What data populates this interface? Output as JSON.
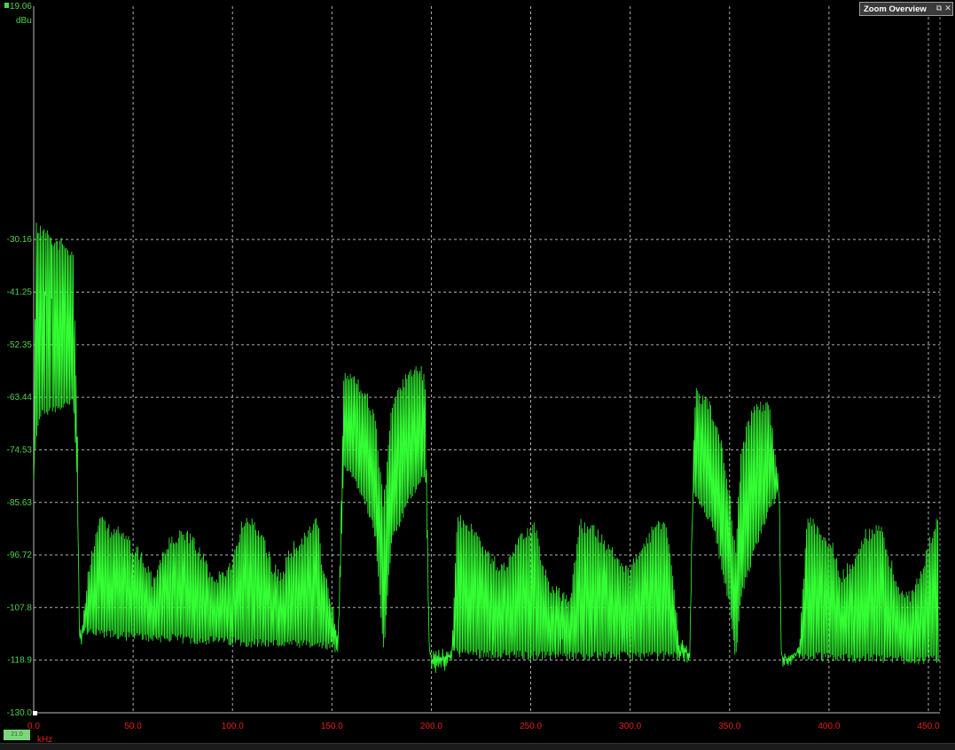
{
  "zoom_overview": {
    "label": "Zoom Overview",
    "restore_icon": "restore-icon",
    "close_icon": "close-icon"
  },
  "corner_readout": "21.0",
  "colors": {
    "background": "#000000",
    "trace": "#33ff33",
    "y_labels": "#4dd24d",
    "x_labels": "#e02020",
    "grid": "#cfcfcf"
  },
  "chart_data": {
    "type": "line",
    "title": "",
    "xlabel": "kHz",
    "ylabel": "dBu",
    "xlim": [
      0,
      455
    ],
    "ylim": [
      -130.0,
      19.06
    ],
    "y_ticks": [
      "19.06",
      "-30.16",
      "-41.25",
      "-52.35",
      "-63.44",
      "-74.53",
      "-85.63",
      "-96.72",
      "-107.8",
      "-118.9",
      "-130.0"
    ],
    "x_ticks": [
      "0.0",
      "50.0",
      "100.0",
      "150.0",
      "200.0",
      "250.0",
      "300.0",
      "350.0",
      "400.0",
      "450.0"
    ],
    "grid": true,
    "series": [
      {
        "values_description_free": true,
        "envelope_upper": [
          [
            0,
            -79
          ],
          [
            1,
            -26
          ],
          [
            5,
            -27
          ],
          [
            10,
            -29
          ],
          [
            15,
            -30
          ],
          [
            20,
            -31
          ],
          [
            22,
            -70
          ],
          [
            23,
            -113
          ],
          [
            24,
            -113
          ],
          [
            27,
            -100
          ],
          [
            33,
            -88
          ],
          [
            38,
            -90
          ],
          [
            45,
            -91
          ],
          [
            50,
            -94
          ],
          [
            55,
            -96
          ],
          [
            60,
            -101
          ],
          [
            63,
            -97
          ],
          [
            68,
            -93
          ],
          [
            75,
            -91
          ],
          [
            80,
            -92
          ],
          [
            85,
            -96
          ],
          [
            90,
            -101
          ],
          [
            100,
            -97
          ],
          [
            105,
            -88
          ],
          [
            110,
            -89
          ],
          [
            115,
            -91
          ],
          [
            120,
            -98
          ],
          [
            125,
            -100
          ],
          [
            128,
            -95
          ],
          [
            135,
            -92
          ],
          [
            140,
            -90
          ],
          [
            143,
            -88
          ],
          [
            145,
            -97
          ],
          [
            152,
            -110
          ],
          [
            153,
            -113
          ],
          [
            154,
            -99
          ],
          [
            156,
            -57
          ],
          [
            160,
            -58
          ],
          [
            167,
            -61
          ],
          [
            172,
            -68
          ],
          [
            176,
            -85
          ],
          [
            180,
            -64
          ],
          [
            188,
            -57
          ],
          [
            195,
            -56
          ],
          [
            197,
            -60
          ],
          [
            199,
            -116
          ],
          [
            200,
            -119
          ],
          [
            210,
            -118
          ],
          [
            213,
            -88
          ],
          [
            220,
            -89
          ],
          [
            225,
            -93
          ],
          [
            230,
            -96
          ],
          [
            235,
            -98
          ],
          [
            238,
            -97
          ],
          [
            245,
            -91
          ],
          [
            252,
            -89
          ],
          [
            255,
            -96
          ],
          [
            260,
            -103
          ],
          [
            270,
            -104
          ],
          [
            275,
            -89
          ],
          [
            282,
            -90
          ],
          [
            290,
            -94
          ],
          [
            297,
            -99
          ],
          [
            300,
            -98
          ],
          [
            305,
            -94
          ],
          [
            312,
            -90
          ],
          [
            318,
            -88
          ],
          [
            321,
            -98
          ],
          [
            325,
            -116
          ],
          [
            330,
            -118
          ],
          [
            332,
            -70
          ],
          [
            333,
            -61
          ],
          [
            340,
            -64
          ],
          [
            345,
            -70
          ],
          [
            350,
            -82
          ],
          [
            353,
            -95
          ],
          [
            356,
            -72
          ],
          [
            362,
            -65
          ],
          [
            370,
            -63
          ],
          [
            375,
            -82
          ],
          [
            376,
            -114
          ],
          [
            377,
            -118
          ],
          [
            385,
            -116
          ],
          [
            389,
            -88
          ],
          [
            395,
            -90
          ],
          [
            402,
            -94
          ],
          [
            406,
            -100
          ],
          [
            412,
            -97
          ],
          [
            418,
            -91
          ],
          [
            426,
            -90
          ],
          [
            430,
            -96
          ],
          [
            436,
            -103
          ],
          [
            442,
            -104
          ],
          [
            447,
            -98
          ],
          [
            455,
            -87
          ]
        ],
        "envelope_lower": [
          [
            0,
            -79
          ],
          [
            3,
            -68
          ],
          [
            10,
            -67
          ],
          [
            20,
            -65
          ],
          [
            22,
            -85
          ],
          [
            23,
            -114
          ],
          [
            50,
            -115
          ],
          [
            100,
            -116
          ],
          [
            150,
            -117
          ],
          [
            153,
            -119
          ],
          [
            156,
            -78
          ],
          [
            166,
            -85
          ],
          [
            172,
            -94
          ],
          [
            176,
            -118
          ],
          [
            180,
            -95
          ],
          [
            190,
            -85
          ],
          [
            197,
            -80
          ],
          [
            199,
            -118
          ],
          [
            250,
            -119
          ],
          [
            325,
            -119
          ],
          [
            332,
            -84
          ],
          [
            342,
            -92
          ],
          [
            350,
            -108
          ],
          [
            353,
            -120
          ],
          [
            356,
            -106
          ],
          [
            366,
            -92
          ],
          [
            375,
            -84
          ],
          [
            376,
            -119
          ],
          [
            455,
            -120
          ]
        ]
      }
    ]
  }
}
